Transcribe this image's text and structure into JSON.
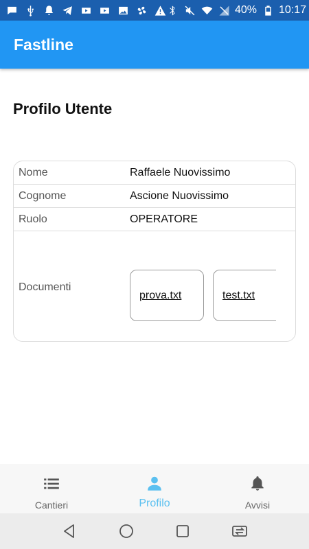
{
  "status_bar": {
    "left_icons": [
      "chat-icon",
      "usb-icon",
      "notification-bell-icon",
      "telegram-icon",
      "youtube-icon",
      "youtube-icon",
      "image-icon",
      "fan-icon",
      "warning-icon"
    ],
    "right_icons": [
      "bluetooth-icon",
      "mute-icon",
      "wifi-icon",
      "no-signal-icon"
    ],
    "battery": "40%",
    "time": "10:17"
  },
  "app_bar": {
    "title": "Fastline"
  },
  "page": {
    "title": "Profilo Utente"
  },
  "profile": {
    "rows": [
      {
        "label": "Nome",
        "value": "Raffaele Nuovissimo"
      },
      {
        "label": "Cognome",
        "value": "Ascione Nuovissimo"
      },
      {
        "label": "Ruolo",
        "value": "OPERATORE"
      }
    ],
    "documents_label": "Documenti",
    "documents": [
      "prova.txt",
      "test.txt"
    ]
  },
  "bottom_nav": {
    "items": [
      {
        "label": "Cantieri",
        "icon": "list-icon",
        "active": false
      },
      {
        "label": "Profilo",
        "icon": "person-icon",
        "active": true
      },
      {
        "label": "Avvisi",
        "icon": "bell-icon",
        "active": false
      }
    ]
  },
  "colors": {
    "status_bar": "#1b5fae",
    "app_bar": "#2196f3",
    "active_nav": "#5bc0f0",
    "inactive_nav": "#666666"
  }
}
